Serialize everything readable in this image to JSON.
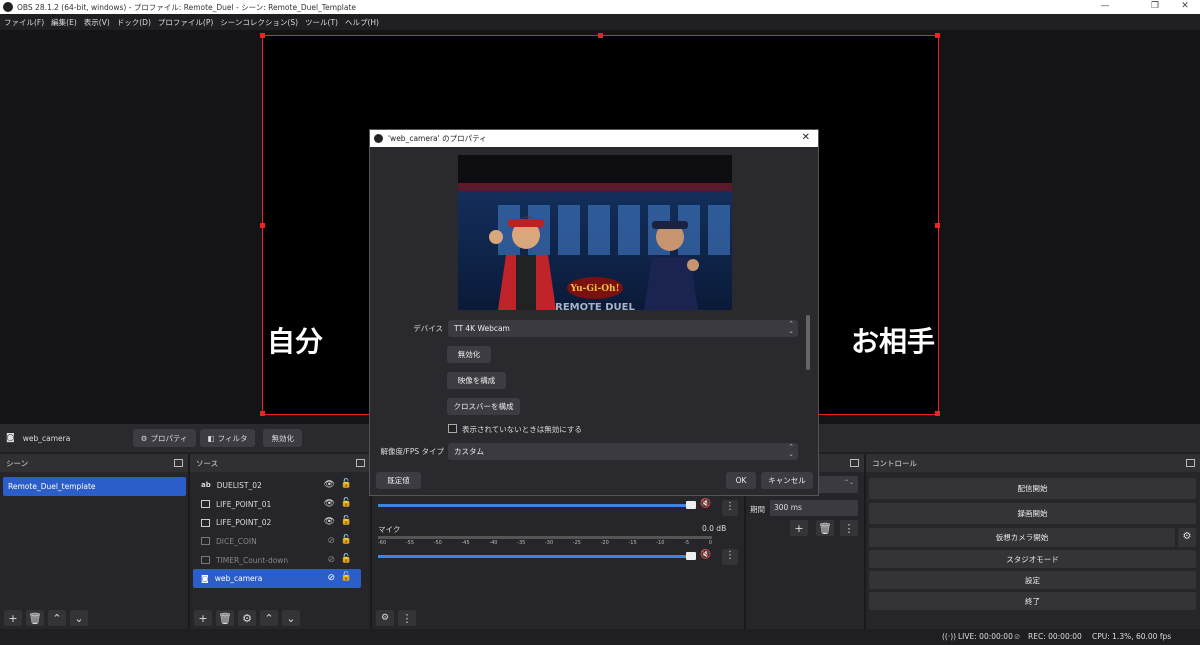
{
  "window": {
    "title": "OBS 28.1.2 (64-bit, windows) - プロファイル: Remote_Duel - シーン: Remote_Duel_Template",
    "min": "—",
    "max": "❐",
    "close": "✕"
  },
  "menu": [
    "ファイル(F)",
    "編集(E)",
    "表示(V)",
    "ドック(D)",
    "プロファイル(P)",
    "シーンコレクション(S)",
    "ツール(T)",
    "ヘルプ(H)"
  ],
  "preview": {
    "left_label": "自分",
    "right_label": "お相手"
  },
  "source_toolbar": {
    "source_name": "web_camera",
    "properties": "プロパティ",
    "filters": "フィルタ",
    "disable": "無効化"
  },
  "scenes": {
    "title": "シーン",
    "items": [
      "Remote_Duel_template"
    ]
  },
  "sources": {
    "title": "ソース",
    "items": [
      {
        "name": "DUELIST_02",
        "icon": "ab"
      },
      {
        "name": "LIFE_POINT_01",
        "icon": ""
      },
      {
        "name": "LIFE_POINT_02",
        "icon": ""
      },
      {
        "name": "DICE_COIN",
        "icon": ""
      },
      {
        "name": "TIMER_Count-down",
        "icon": ""
      },
      {
        "name": "web_camera",
        "icon": "cam"
      }
    ]
  },
  "mixer": {
    "mic_label": "マイク",
    "mic_db": "0.0 dB",
    "ticks": [
      "-60",
      "-55",
      "-50",
      "-45",
      "-40",
      "-35",
      "-30",
      "-25",
      "-20",
      "-15",
      "-10",
      "-5",
      "0"
    ]
  },
  "transitions": {
    "duration_label": "期間",
    "duration_value": "300 ms"
  },
  "controls": {
    "title": "コントロール",
    "start_stream": "配信開始",
    "start_record": "録画開始",
    "virtual_cam": "仮想カメラ開始",
    "studio_mode": "スタジオモード",
    "settings": "設定",
    "exit": "終了"
  },
  "status": {
    "live": "LIVE: 00:00:00",
    "rec": "REC: 00:00:00",
    "cpu": "CPU: 1.3%, 60.00 fps"
  },
  "dialog": {
    "title": "'web_camera' のプロパティ",
    "device_label": "デバイス",
    "device_value": "TT 4K Webcam",
    "deactivate": "無効化",
    "configure_video": "映像を構成",
    "configure_crossbar": "クロスバーを構成",
    "hide_checkbox": "表示されていないときは無効にする",
    "resolution_label": "解像度/FPS タイプ",
    "resolution_value": "カスタム",
    "defaults": "既定値",
    "ok": "OK",
    "cancel": "キャンセル",
    "cam_logo": "Yu-Gi-Oh!",
    "cam_banner": "REMOTE DUEL"
  }
}
